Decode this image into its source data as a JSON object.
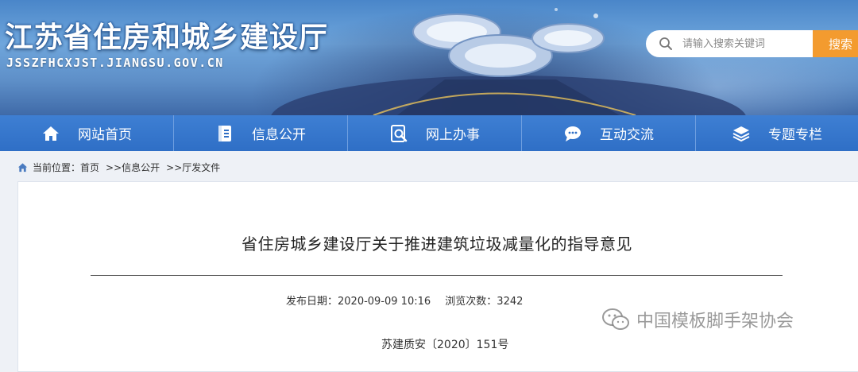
{
  "header": {
    "site_title": "江苏省住房和城乡建设厅",
    "site_domain": "JSSZFHCXJST.JIANGSU.GOV.CN",
    "search_placeholder": "请输入搜索关键词",
    "search_button": "搜索"
  },
  "nav": {
    "items": [
      {
        "label": "网站首页",
        "icon": "home-icon"
      },
      {
        "label": "信息公开",
        "icon": "document-icon"
      },
      {
        "label": "网上办事",
        "icon": "search-document-icon"
      },
      {
        "label": "互动交流",
        "icon": "chat-bubble-icon"
      },
      {
        "label": "专题专栏",
        "icon": "layers-icon"
      }
    ]
  },
  "breadcrumb": {
    "prefix": "当前位置：首页",
    "items": [
      ">>信息公开",
      ">>厅发文件"
    ]
  },
  "article": {
    "title": "省住房城乡建设厅关于推进建筑垃圾减量化的指导意见",
    "publish_label": "发布日期：2020-09-09 10:16",
    "views_label": "浏览次数：3242",
    "doc_number": "苏建质安〔2020〕151号"
  },
  "watermark": {
    "text": "中国模板脚手架协会",
    "icon": "wechat-icon"
  },
  "colors": {
    "nav_bg": "#2f6fc6",
    "search_button": "#f39b2f",
    "banner": "#5e8fc8"
  }
}
